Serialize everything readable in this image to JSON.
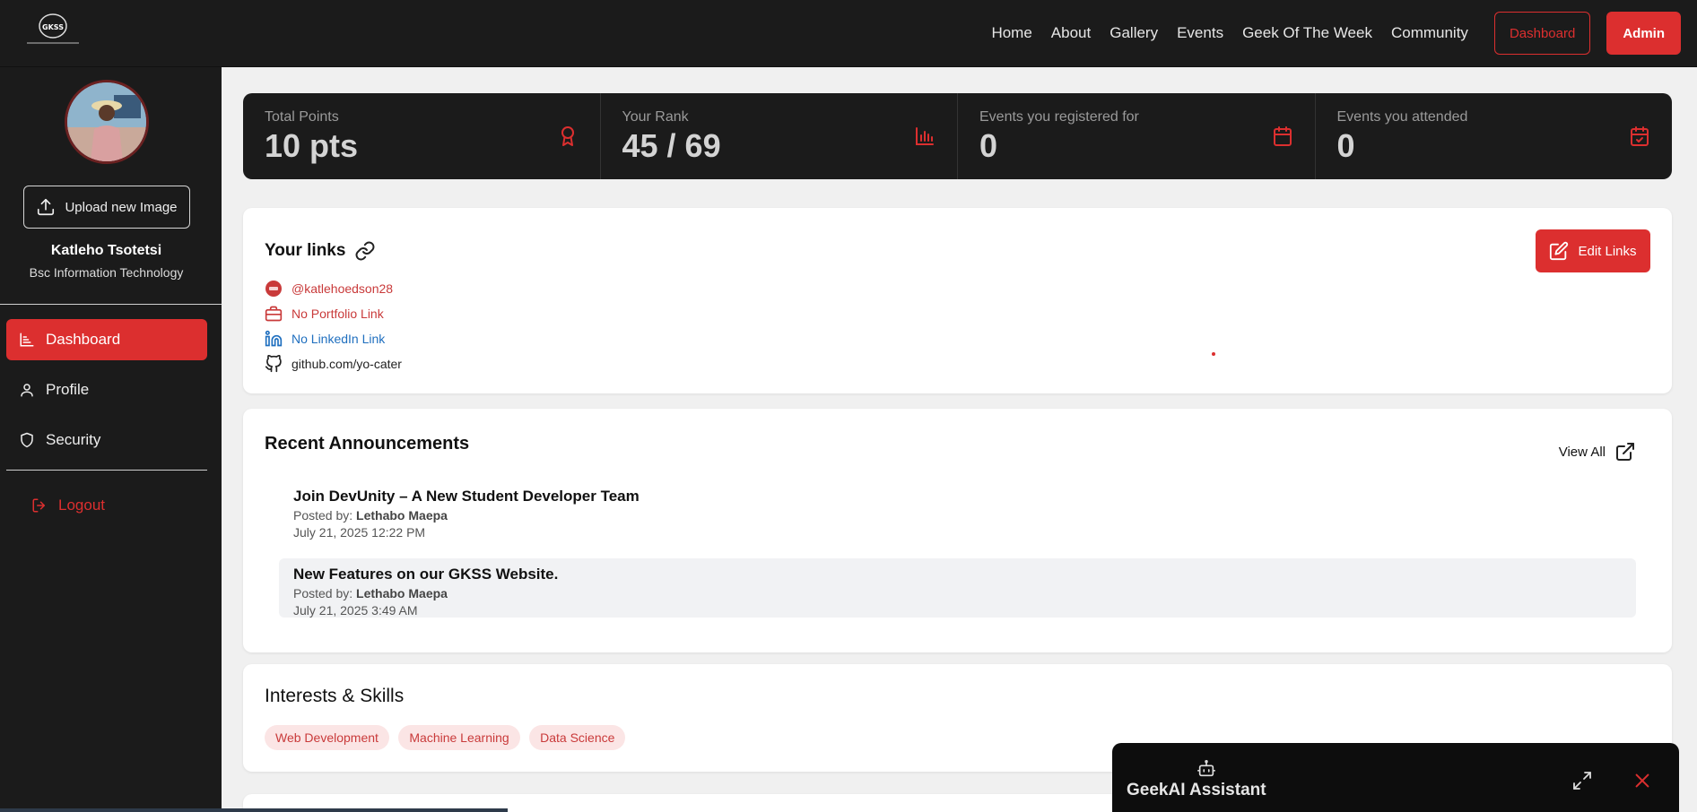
{
  "brand": {
    "logo_text": "GKSS"
  },
  "nav": {
    "links": [
      "Home",
      "About",
      "Gallery",
      "Events",
      "Geek Of The Week",
      "Community"
    ],
    "dashboard_label": "Dashboard",
    "admin_label": "Admin"
  },
  "sidebar": {
    "upload_label": "Upload new Image",
    "user_name": "Katleho Tsotetsi",
    "user_degree": "Bsc Information Technology",
    "items": [
      {
        "label": "Dashboard",
        "icon": "chart-icon",
        "active": true
      },
      {
        "label": "Profile",
        "icon": "user-icon",
        "active": false
      },
      {
        "label": "Security",
        "icon": "shield-icon",
        "active": false
      }
    ],
    "logout_label": "Logout"
  },
  "stats": [
    {
      "label": "Total Points",
      "value": "10 pts",
      "icon": "award-icon"
    },
    {
      "label": "Your Rank",
      "value": "45 / 69",
      "icon": "bar-chart-icon"
    },
    {
      "label": "Events you registered for",
      "value": "0",
      "icon": "calendar-icon"
    },
    {
      "label": "Events you attended",
      "value": "0",
      "icon": "calendar-check-icon"
    }
  ],
  "links_card": {
    "title": "Your links",
    "edit_label": "Edit Links",
    "links": [
      {
        "text": "@katlehoedson28",
        "icon": "avatar-icon",
        "color": "#c93a3a"
      },
      {
        "text": "No Portfolio Link",
        "icon": "briefcase-icon",
        "color": "#c93a3a"
      },
      {
        "text": "No LinkedIn Link",
        "icon": "linkedin-icon",
        "color": "#1f6fbf"
      },
      {
        "text": "github.com/yo-cater",
        "icon": "github-icon",
        "color": "#222222"
      }
    ]
  },
  "announcements": {
    "title": "Recent Announcements",
    "view_all_label": "View All",
    "items": [
      {
        "title": "Join DevUnity – A New Student Developer Team",
        "posted_prefix": "Posted by:",
        "author": "Lethabo Maepa",
        "date": "July 21, 2025 12:22 PM"
      },
      {
        "title": "New Features on our GKSS Website.",
        "posted_prefix": "Posted by:",
        "author": "Lethabo Maepa",
        "date": "July 21, 2025 3:49 AM"
      }
    ]
  },
  "interests": {
    "title": "Interests & Skills",
    "tags": [
      "Web Development",
      "Machine Learning",
      "Data Science"
    ]
  },
  "assistant": {
    "title": "GeekAI Assistant"
  },
  "colors": {
    "accent": "#dc2f2f",
    "dark": "#1b1b1b",
    "linkedin": "#1f6fbf"
  }
}
